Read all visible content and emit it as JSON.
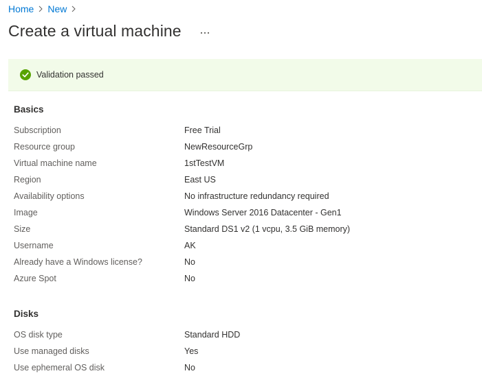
{
  "breadcrumb": {
    "items": [
      {
        "label": "Home"
      },
      {
        "label": "New"
      }
    ]
  },
  "page": {
    "title": "Create a virtual machine",
    "more_icon": "more-options-icon"
  },
  "validation": {
    "message": "Validation passed",
    "icon": "check-circle-icon",
    "color": "#57a300",
    "background": "#f2fbe9"
  },
  "basics": {
    "title": "Basics",
    "rows": [
      {
        "label": "Subscription",
        "value": "Free Trial"
      },
      {
        "label": "Resource group",
        "value": "NewResourceGrp"
      },
      {
        "label": "Virtual machine name",
        "value": "1stTestVM"
      },
      {
        "label": "Region",
        "value": "East US"
      },
      {
        "label": "Availability options",
        "value": "No infrastructure redundancy required"
      },
      {
        "label": "Image",
        "value": "Windows Server 2016 Datacenter - Gen1"
      },
      {
        "label": "Size",
        "value": "Standard DS1 v2 (1 vcpu, 3.5 GiB memory)"
      },
      {
        "label": "Username",
        "value": "AK"
      },
      {
        "label": "Already have a Windows license?",
        "value": "No"
      },
      {
        "label": "Azure Spot",
        "value": "No"
      }
    ]
  },
  "disks": {
    "title": "Disks",
    "rows": [
      {
        "label": "OS disk type",
        "value": "Standard HDD"
      },
      {
        "label": "Use managed disks",
        "value": "Yes"
      },
      {
        "label": "Use ephemeral OS disk",
        "value": "No"
      }
    ]
  },
  "colors": {
    "link": "#0078d4",
    "text": "#323130",
    "label": "#605e5c"
  }
}
